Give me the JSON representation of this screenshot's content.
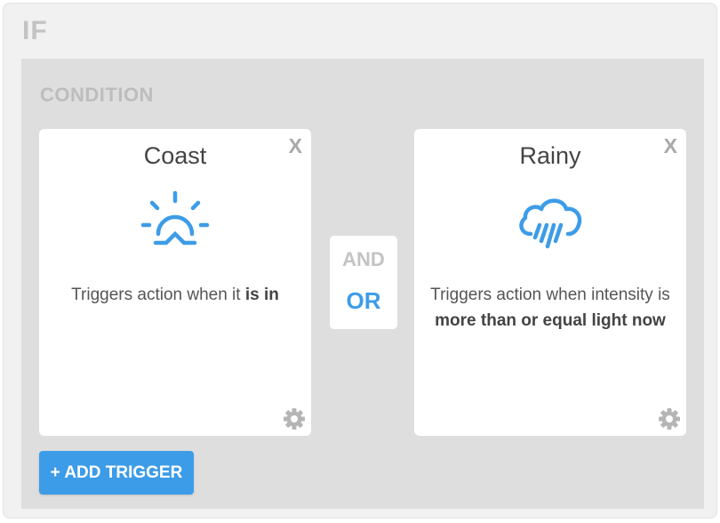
{
  "section_title": "IF",
  "condition": {
    "title": "CONDITION",
    "cards": [
      {
        "title": "Coast",
        "close_label": "X",
        "icon": "sunrise-icon",
        "desc_prefix": "Triggers action when it ",
        "desc_bold": "is in"
      },
      {
        "title": "Rainy",
        "close_label": "X",
        "icon": "rain-cloud-icon",
        "desc_prefix": "Triggers action when intensity is ",
        "desc_bold": "more than or equal light now"
      }
    ],
    "logic": {
      "and_label": "AND",
      "or_label": "OR",
      "selected": "OR"
    },
    "add_trigger_label": "+ ADD TRIGGER"
  },
  "colors": {
    "accent": "#3d9ce8",
    "muted_heading": "#c3c3c3",
    "panel_bg": "#dedede"
  }
}
